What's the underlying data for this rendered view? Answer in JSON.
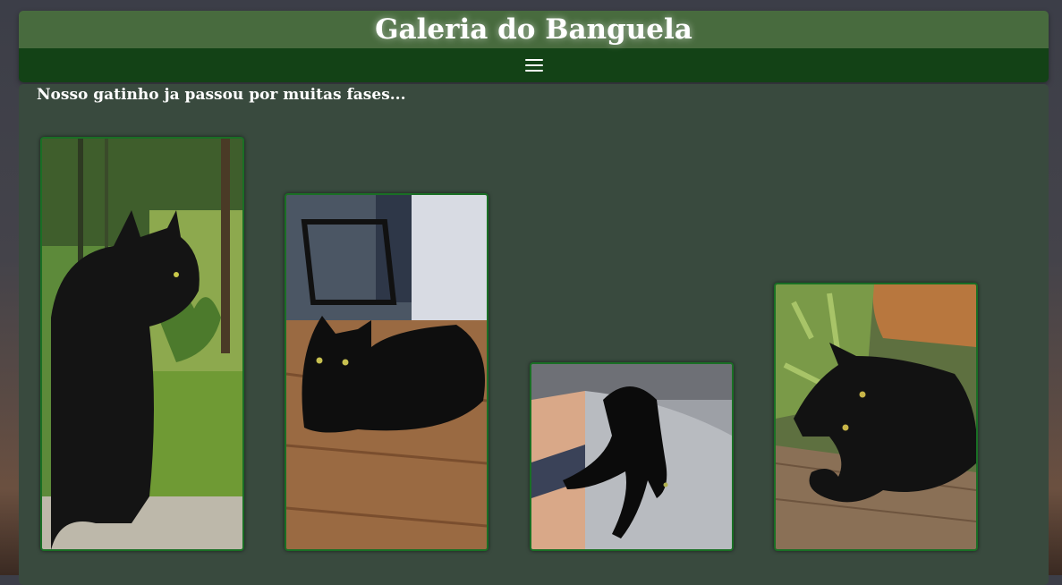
{
  "header": {
    "title": "Galeria do Banguela"
  },
  "nav": {
    "menu_icon": "hamburger-menu-icon"
  },
  "main": {
    "intro_text": "Nosso gatinho ja passou por muitas fases...",
    "photos": [
      {
        "subject": "black cat sitting in garden"
      },
      {
        "subject": "black cat lying on wooden floor"
      },
      {
        "subject": "black cat lying on sofa"
      },
      {
        "subject": "black cat lying on wooden bench"
      }
    ]
  },
  "colors": {
    "title_bar": "#486b3e",
    "nav_bar": "#134216",
    "content_panel": "#394a3e",
    "photo_border": "#1a6f25"
  }
}
